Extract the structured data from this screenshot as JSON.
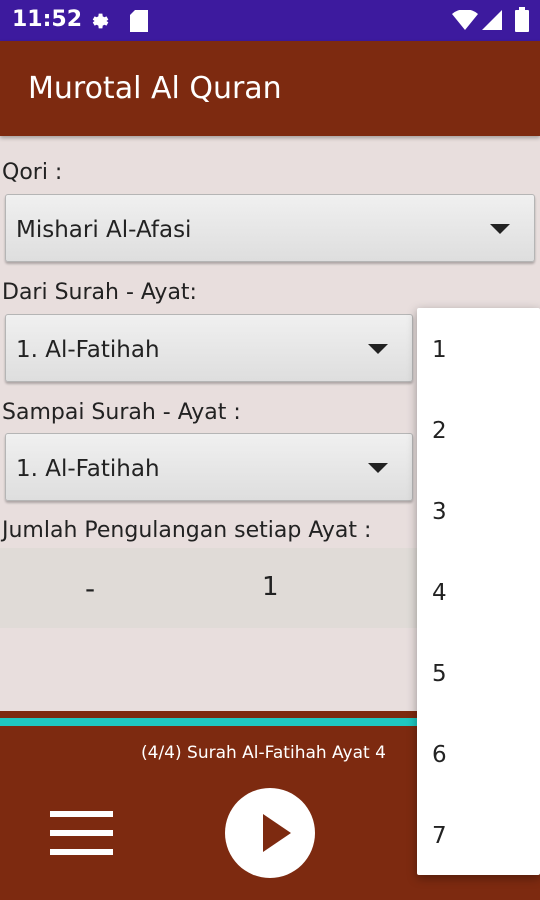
{
  "status": {
    "time": "11:52"
  },
  "appbar": {
    "title": "Murotal Al Quran"
  },
  "form": {
    "qori_label": "Qori :",
    "qori_value": "Mishari Al-Afasi",
    "from_label": "Dari Surah - Ayat:",
    "from_value": "1. Al-Fatihah",
    "to_label": "Sampai Surah - Ayat :",
    "to_value": "1. Al-Fatihah",
    "repeat_label": "Jumlah Pengulangan setiap Ayat :",
    "repeat_minus": "-",
    "repeat_value": "1"
  },
  "player": {
    "now_playing": "(4/4) Surah Al-Fatihah Ayat 4"
  },
  "dropdown": {
    "items": [
      "1",
      "2",
      "3",
      "4",
      "5",
      "6",
      "7"
    ]
  },
  "colors": {
    "appbar": "#7d2a10",
    "statusbar": "#3d1a9e",
    "accent": "#1fc7c0",
    "background": "#e8dedd"
  },
  "icons": [
    "gear-icon",
    "sd-card-icon",
    "wifi-icon",
    "signal-icon",
    "battery-icon",
    "dropdown-caret-icon",
    "menu-icon",
    "play-icon"
  ]
}
